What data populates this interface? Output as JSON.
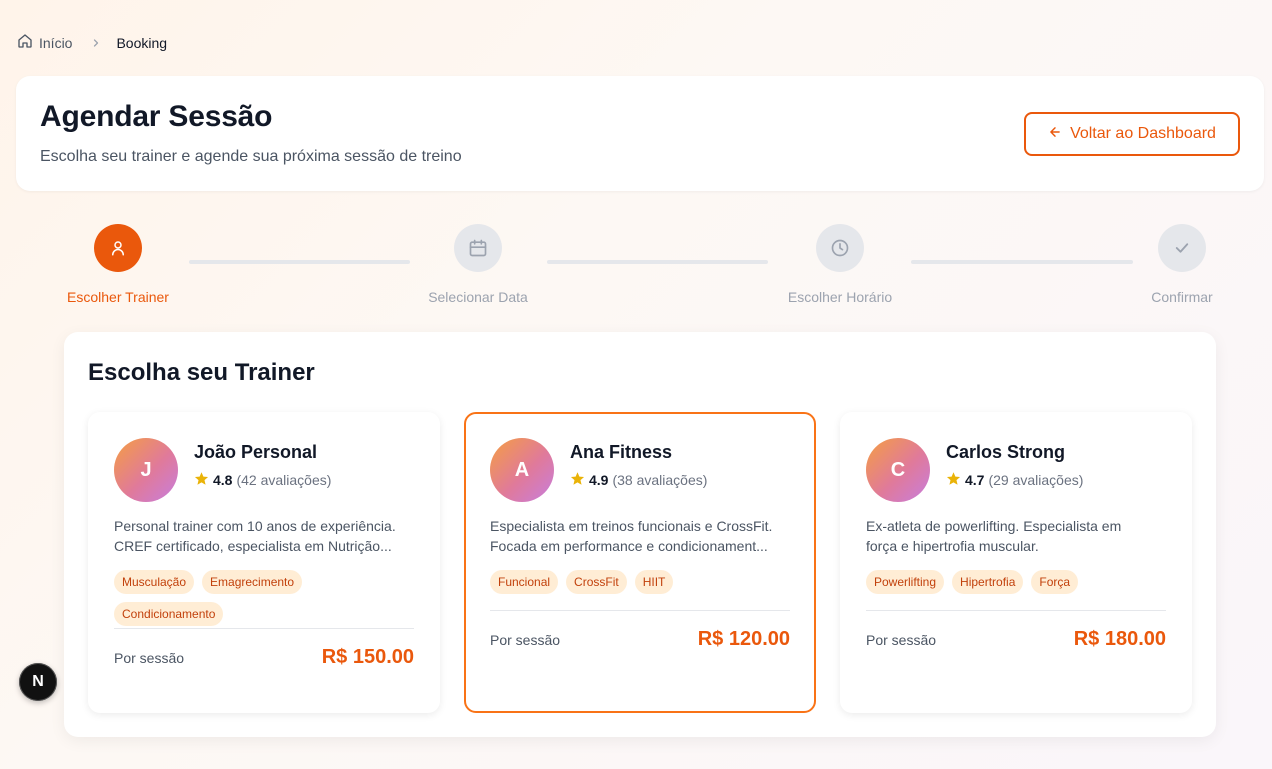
{
  "breadcrumb": {
    "home_label": "Início",
    "home_icon": "home-icon",
    "separator_icon": "chevron-right-icon",
    "current": "Booking"
  },
  "header": {
    "title": "Agendar Sessão",
    "subtitle": "Escolha seu trainer e agende sua próxima sessão de treino",
    "back_button": "Voltar ao Dashboard",
    "back_icon": "arrow-left-icon"
  },
  "stepper": {
    "steps": [
      {
        "label": "Escolher Trainer",
        "icon": "user-icon",
        "active": true
      },
      {
        "label": "Selecionar Data",
        "icon": "calendar-icon",
        "active": false
      },
      {
        "label": "Escolher Horário",
        "icon": "clock-icon",
        "active": false
      },
      {
        "label": "Confirmar",
        "icon": "check-icon",
        "active": false
      }
    ]
  },
  "trainers_section": {
    "title": "Escolha seu Trainer",
    "trainers": [
      {
        "initial": "J",
        "name": "João Personal",
        "rating": "4.8",
        "reviews": "(42 avaliações)",
        "description_line1": "Personal trainer com 10 anos de experiência.",
        "description_line2": "CREF certificado, especialista em Nutrição...",
        "tags": [
          "Musculação",
          "Emagrecimento",
          "Condicionamento"
        ],
        "per_session_label": "Por sessão",
        "price": "R$ 150.00",
        "selected": false
      },
      {
        "initial": "A",
        "name": "Ana Fitness",
        "rating": "4.9",
        "reviews": "(38 avaliações)",
        "description_line1": "Especialista em treinos funcionais e CrossFit.",
        "description_line2": "Focada em performance e condicionament...",
        "tags": [
          "Funcional",
          "CrossFit",
          "HIIT"
        ],
        "per_session_label": "Por sessão",
        "price": "R$ 120.00",
        "selected": true
      },
      {
        "initial": "C",
        "name": "Carlos Strong",
        "rating": "4.7",
        "reviews": "(29 avaliações)",
        "description_line1": "Ex-atleta de powerlifting. Especialista em",
        "description_line2": "força e hipertrofia muscular.",
        "tags": [
          "Powerlifting",
          "Hipertrofia",
          "Força"
        ],
        "per_session_label": "Por sessão",
        "price": "R$ 180.00",
        "selected": false
      }
    ]
  },
  "floating_badge": {
    "label": "N"
  },
  "colors": {
    "accent": "#ea580c",
    "star": "#eab308",
    "tag_bg": "#ffedd5",
    "tag_text": "#c2410c"
  }
}
